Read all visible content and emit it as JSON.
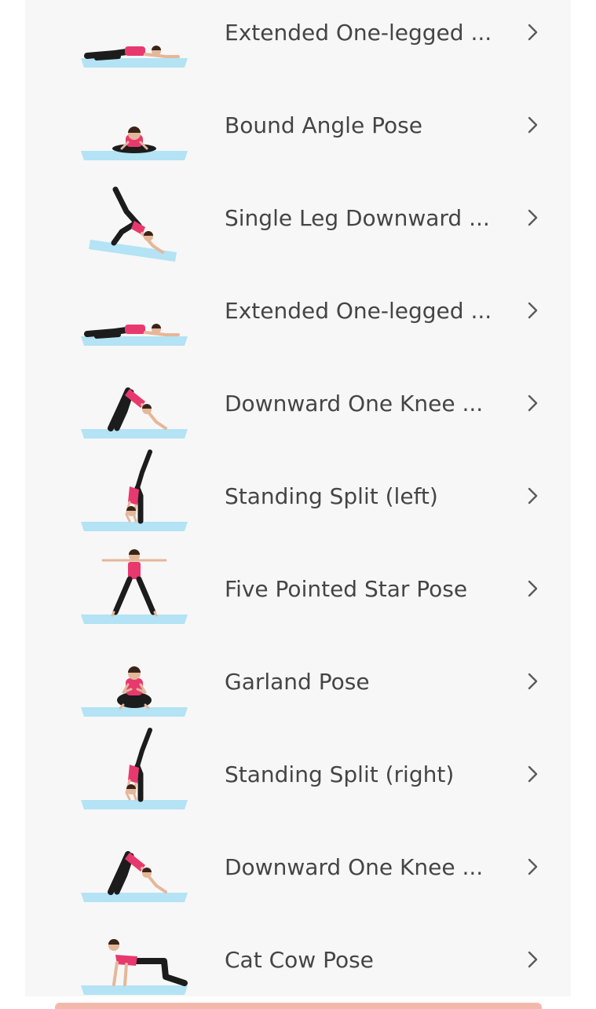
{
  "poses": [
    {
      "label": "Extended One-legged ...",
      "figure": "lying-forward-fold-icon"
    },
    {
      "label": "Bound Angle Pose",
      "figure": "bound-angle-icon"
    },
    {
      "label": "Single Leg Downward ...",
      "figure": "single-leg-down-dog-icon"
    },
    {
      "label": "Extended One-legged ...",
      "figure": "lying-forward-fold-icon"
    },
    {
      "label": "Downward One Knee ...",
      "figure": "downward-dog-icon"
    },
    {
      "label": "Standing Split (left)",
      "figure": "standing-split-icon"
    },
    {
      "label": "Five Pointed Star Pose",
      "figure": "star-pose-icon"
    },
    {
      "label": "Garland Pose",
      "figure": "garland-pose-icon"
    },
    {
      "label": "Standing Split (right)",
      "figure": "standing-split-icon"
    },
    {
      "label": "Downward One Knee ...",
      "figure": "downward-dog-icon"
    },
    {
      "label": "Cat Cow Pose",
      "figure": "cat-cow-icon"
    }
  ],
  "colors": {
    "mat": "#b3e3f4",
    "top": "#e8396e",
    "legs": "#1c1c1c",
    "skin": "#e5b799",
    "hair": "#3a2419",
    "text": "#454545",
    "chevron": "#5a5a5a",
    "list_bg": "#f7f7f7"
  }
}
